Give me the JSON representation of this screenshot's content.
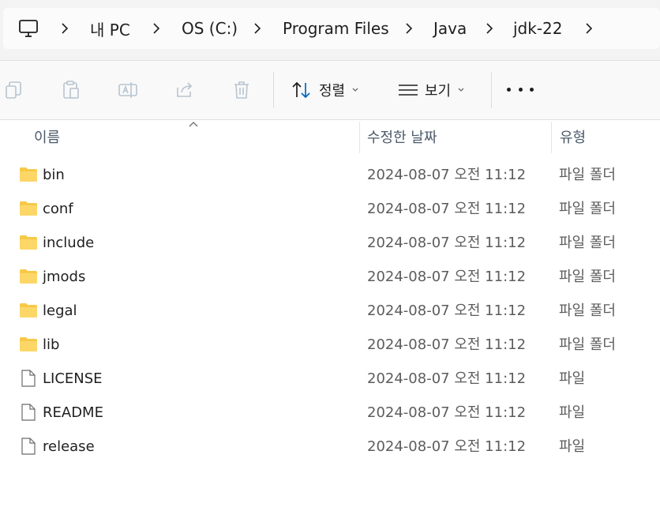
{
  "breadcrumb": {
    "items": [
      "내 PC",
      "OS (C:)",
      "Program Files",
      "Java",
      "jdk-22"
    ]
  },
  "toolbar": {
    "sort_label": "정렬",
    "view_label": "보기"
  },
  "columns": {
    "name": "이름",
    "modified": "수정한 날짜",
    "type": "유형"
  },
  "files": [
    {
      "name": "bin",
      "modified": "2024-08-07 오전 11:12",
      "type": "파일 폴더",
      "kind": "folder"
    },
    {
      "name": "conf",
      "modified": "2024-08-07 오전 11:12",
      "type": "파일 폴더",
      "kind": "folder"
    },
    {
      "name": "include",
      "modified": "2024-08-07 오전 11:12",
      "type": "파일 폴더",
      "kind": "folder"
    },
    {
      "name": "jmods",
      "modified": "2024-08-07 오전 11:12",
      "type": "파일 폴더",
      "kind": "folder"
    },
    {
      "name": "legal",
      "modified": "2024-08-07 오전 11:12",
      "type": "파일 폴더",
      "kind": "folder"
    },
    {
      "name": "lib",
      "modified": "2024-08-07 오전 11:12",
      "type": "파일 폴더",
      "kind": "folder"
    },
    {
      "name": "LICENSE",
      "modified": "2024-08-07 오전 11:12",
      "type": "파일",
      "kind": "file"
    },
    {
      "name": "README",
      "modified": "2024-08-07 오전 11:12",
      "type": "파일",
      "kind": "file"
    },
    {
      "name": "release",
      "modified": "2024-08-07 오전 11:12",
      "type": "파일",
      "kind": "file"
    }
  ],
  "icons": {
    "pc": "computer-icon",
    "copy": "copy-icon",
    "paste": "paste-icon",
    "rename": "rename-icon",
    "share": "share-icon",
    "delete": "delete-icon",
    "sort": "sort-icon",
    "view": "view-icon",
    "more": "more-icon",
    "folder": "folder-icon",
    "file": "file-icon"
  },
  "colors": {
    "folder": "#f7c948",
    "accent": "#0067c0"
  }
}
